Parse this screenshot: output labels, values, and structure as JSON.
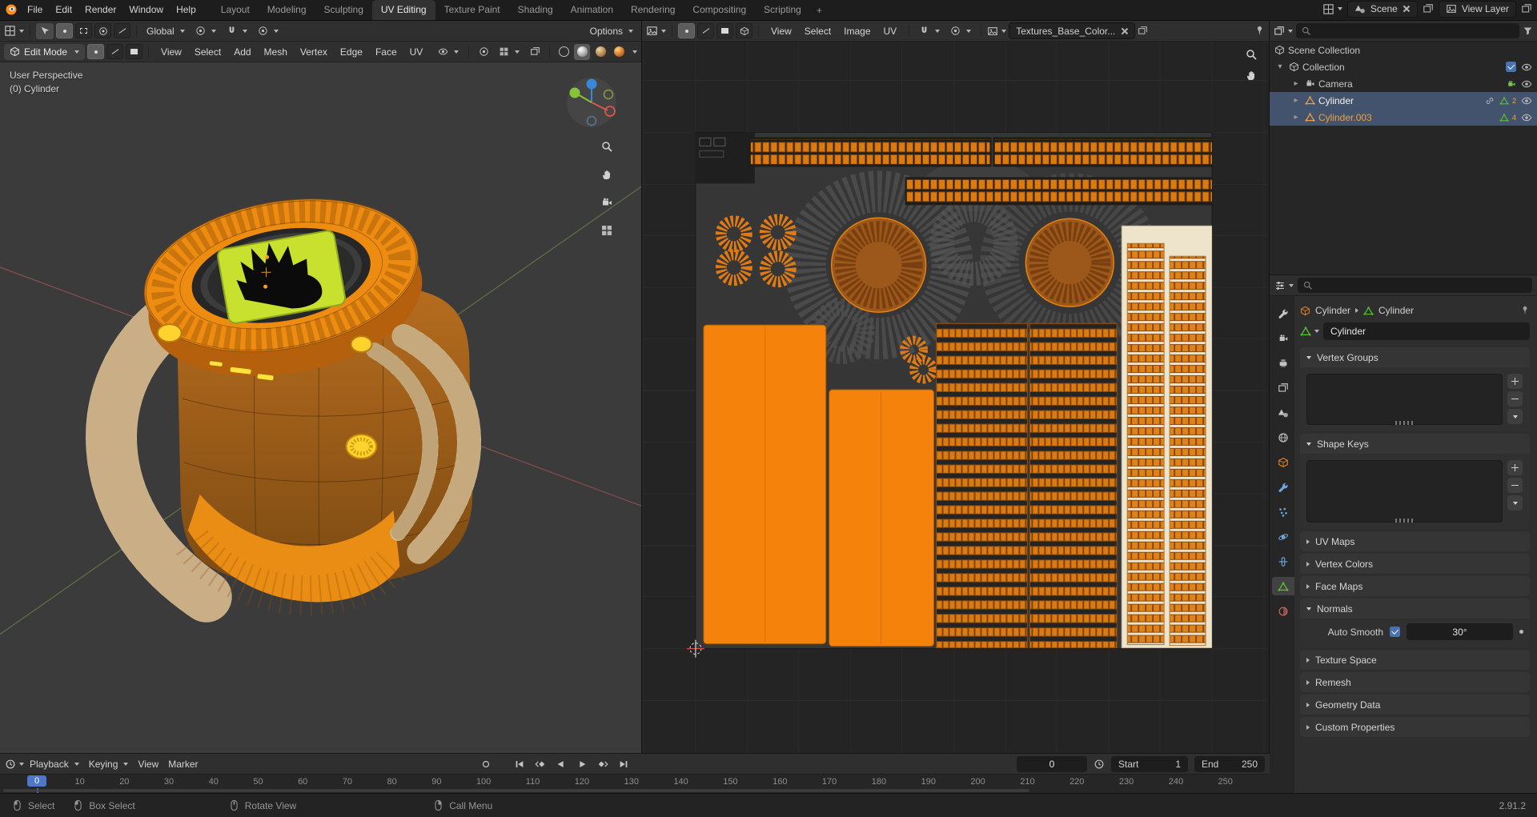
{
  "topbar": {
    "menus": [
      "File",
      "Edit",
      "Render",
      "Window",
      "Help"
    ],
    "tabs": [
      "Layout",
      "Modeling",
      "Sculpting",
      "UV Editing",
      "Texture Paint",
      "Shading",
      "Animation",
      "Rendering",
      "Compositing",
      "Scripting",
      "+"
    ],
    "scene": "Scene",
    "view_layer": "View Layer"
  },
  "viewport": {
    "tool_settings": {
      "orientation": "Global",
      "options": "Options"
    },
    "header": {
      "mode": "Edit Mode",
      "menus": [
        "View",
        "Select",
        "Add",
        "Mesh",
        "Vertex",
        "Edge",
        "Face",
        "UV"
      ]
    },
    "overlay": {
      "line1": "User Perspective",
      "line2": "(0) Cylinder"
    }
  },
  "uv_editor": {
    "menus": [
      "View",
      "Select",
      "Image",
      "UV"
    ],
    "image_name": "Textures_Base_Color..."
  },
  "outliner": {
    "scene_collection": "Scene Collection",
    "collection": "Collection",
    "camera": "Camera",
    "cylinder": "Cylinder",
    "cylinder003": "Cylinder.003",
    "badge2": "2",
    "badge4": "4"
  },
  "properties": {
    "crumb_object": "Cylinder",
    "crumb_data": "Cylinder",
    "name": "Cylinder",
    "vertex_groups": "Vertex Groups",
    "shape_keys": "Shape Keys",
    "uv_maps": "UV Maps",
    "vertex_colors": "Vertex Colors",
    "face_maps": "Face Maps",
    "normals": "Normals",
    "auto_smooth": "Auto Smooth",
    "angle": "30°",
    "texture_space": "Texture Space",
    "remesh": "Remesh",
    "geometry_data": "Geometry Data",
    "custom_properties": "Custom Properties"
  },
  "timeline": {
    "playback": "Playback",
    "keying": "Keying",
    "view": "View",
    "marker": "Marker",
    "frames": [
      "0",
      "10",
      "20",
      "30",
      "40",
      "50",
      "60",
      "70",
      "80",
      "90",
      "100",
      "110",
      "120",
      "130",
      "140",
      "150",
      "160",
      "170",
      "180",
      "190",
      "200",
      "210",
      "220",
      "230",
      "240",
      "250"
    ],
    "current_frame": "0",
    "start_label": "Start",
    "start_value": "1",
    "end_label": "End",
    "end_value": "250"
  },
  "status": {
    "hints": [
      "Select",
      "Box Select",
      "Rotate View",
      "Call Menu"
    ],
    "version": "2.91.2"
  }
}
